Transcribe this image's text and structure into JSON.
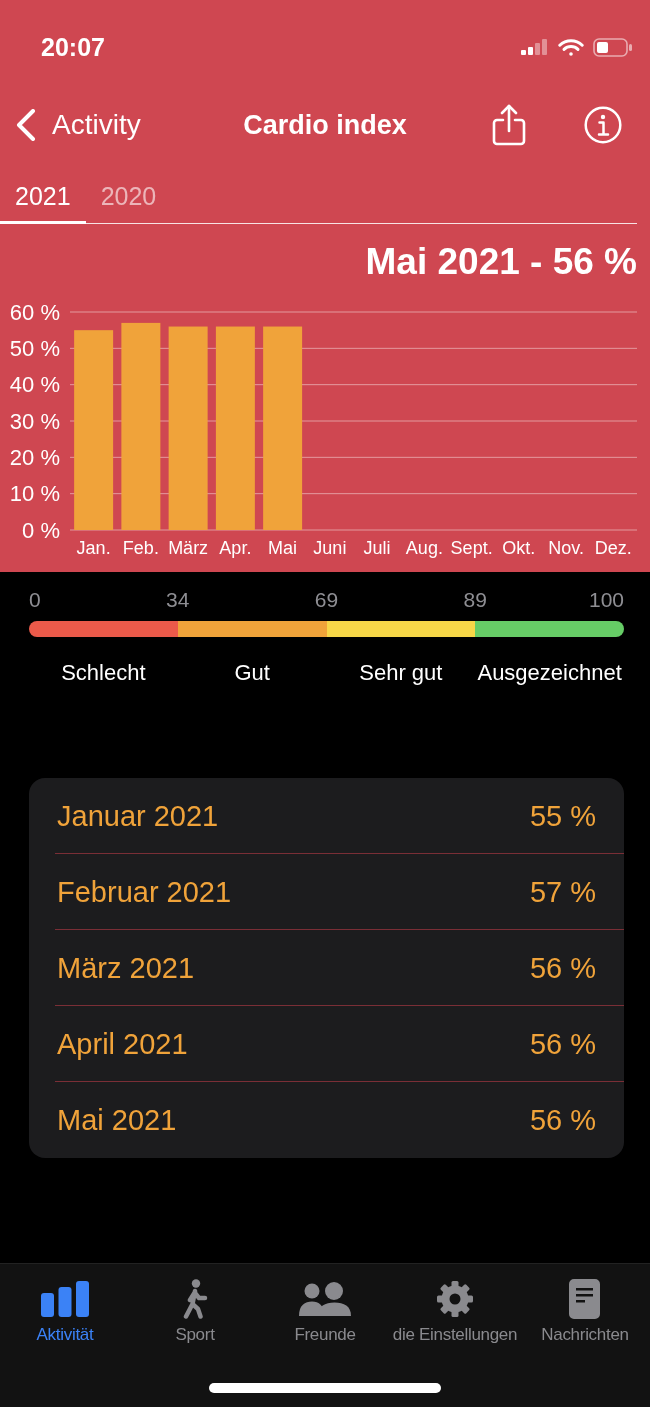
{
  "status_bar": {
    "time": "20:07"
  },
  "nav_bar": {
    "back_label": "Activity",
    "title": "Cardio index"
  },
  "year_tabs": [
    {
      "label": "2021",
      "selected": true
    },
    {
      "label": "2020",
      "selected": false
    }
  ],
  "chart": {
    "chart_data": {
      "type": "bar",
      "title": "Mai 2021 - 56 %",
      "categories": [
        "Jan.",
        "Feb.",
        "März",
        "Apr.",
        "Mai",
        "Juni",
        "Juli",
        "Aug.",
        "Sept.",
        "Okt.",
        "Nov.",
        "Dez."
      ],
      "values": [
        55,
        57,
        56,
        56,
        56,
        null,
        null,
        null,
        null,
        null,
        null,
        null
      ],
      "ylim": [
        0,
        60
      ],
      "yticks": [
        {
          "value": 0,
          "label": "0 %"
        },
        {
          "value": 10,
          "label": "10 %"
        },
        {
          "value": 20,
          "label": "20 %"
        },
        {
          "value": 30,
          "label": "30 %"
        },
        {
          "value": 40,
          "label": "40 %"
        },
        {
          "value": 50,
          "label": "50 %"
        },
        {
          "value": 60,
          "label": "60 %"
        }
      ],
      "grid": true
    }
  },
  "scale": {
    "ticks": [
      "0",
      "34",
      "69",
      "89",
      "100"
    ],
    "bands": [
      {
        "label": "Schlecht",
        "color": "#eb5a4a"
      },
      {
        "label": "Gut",
        "color": "#f0a33a"
      },
      {
        "label": "Sehr gut",
        "color": "#f7d748"
      },
      {
        "label": "Ausgezeichnet",
        "color": "#66cc66"
      }
    ]
  },
  "monthly_values": [
    {
      "month": "Januar 2021",
      "value": "55 %"
    },
    {
      "month": "Februar 2021",
      "value": "57 %"
    },
    {
      "month": "März 2021",
      "value": "56 %"
    },
    {
      "month": "April 2021",
      "value": "56 %"
    },
    {
      "month": "Mai 2021",
      "value": "56 %"
    }
  ],
  "tab_bar": [
    {
      "label": "Aktivität",
      "selected": true
    },
    {
      "label": "Sport",
      "selected": false
    },
    {
      "label": "Freunde",
      "selected": false
    },
    {
      "label": "die Einstellungen",
      "selected": false
    },
    {
      "label": "Nachrichten",
      "selected": false
    }
  ]
}
